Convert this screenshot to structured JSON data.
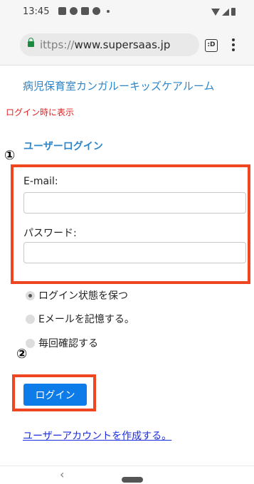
{
  "status_bar": {
    "time": "13:45"
  },
  "browser": {
    "url_scheme": "ittps://",
    "url_host": "www.supersaas.jp",
    "tabs_count": ":D"
  },
  "page": {
    "site_title": "病児保育室カンガルーキッズケアルーム",
    "login_note": "ログイン時に表示",
    "login_heading": "ユーザーログイン",
    "email_label": "E-mail:",
    "email_value": "",
    "password_label": "パスワード:",
    "password_value": "",
    "radio_options": [
      {
        "label": "ログイン状態を保つ",
        "checked": true
      },
      {
        "label": "Eメールを記憶する。",
        "checked": false
      },
      {
        "label": "毎回確認する",
        "checked": false
      }
    ],
    "login_button": "ログイン",
    "create_account_link": "ユーザーアカウントを作成する。"
  },
  "annotations": {
    "marker_1": "①",
    "marker_2": "②",
    "highlight_color": "#ef4521"
  },
  "colors": {
    "title_blue": "#2e86c9",
    "note_red": "#e02020",
    "button_blue": "#0d7be8",
    "link_blue": "#1a2ee0"
  },
  "nav": {
    "back_glyph": "‹"
  }
}
